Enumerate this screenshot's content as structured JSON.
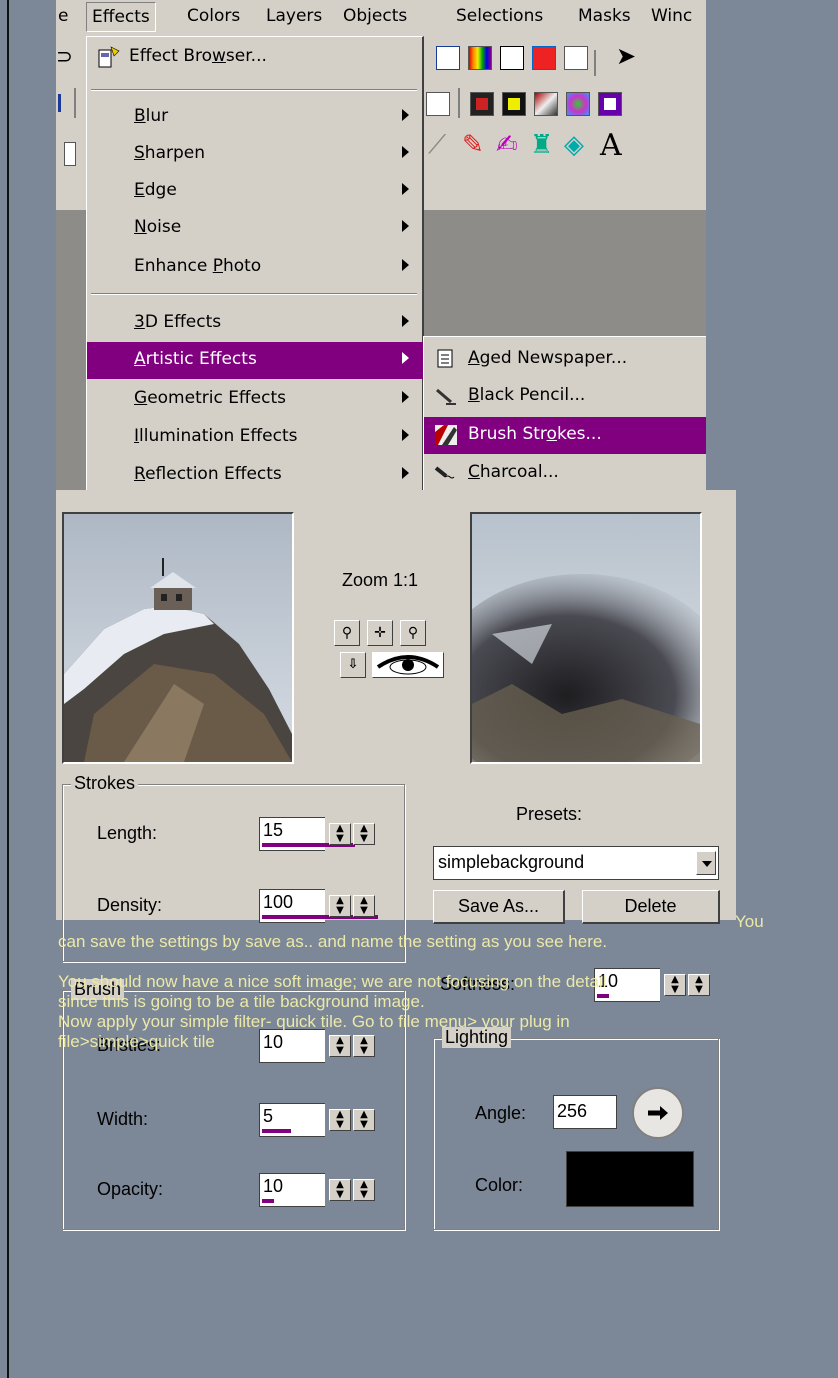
{
  "menubar": {
    "items": [
      {
        "label": "e"
      },
      {
        "label": "Effects"
      },
      {
        "label": "Colors"
      },
      {
        "label": "Layers"
      },
      {
        "label": "Objects"
      },
      {
        "label": "Selections"
      },
      {
        "label": "Masks"
      },
      {
        "label": "Winc"
      }
    ]
  },
  "effects_menu": {
    "browser": {
      "pre": "Effect Bro",
      "u": "w",
      "post": "ser..."
    },
    "group1": [
      {
        "u": "B",
        "rest": "lur"
      },
      {
        "u": "S",
        "rest": "harpen"
      },
      {
        "u": "E",
        "rest": "dge"
      },
      {
        "u": "N",
        "rest": "oise"
      },
      {
        "pre": "Enhance ",
        "u": "P",
        "rest": "hoto"
      }
    ],
    "group2": [
      {
        "u": "3",
        "rest": "D Effects"
      },
      {
        "u": "A",
        "rest": "rtistic Effects"
      },
      {
        "u": "G",
        "rest": "eometric Effects"
      },
      {
        "u": "I",
        "rest": "llumination Effects"
      },
      {
        "u": "R",
        "rest": "eflection Effects"
      }
    ]
  },
  "artistic_submenu": [
    {
      "pre": "",
      "u": "A",
      "rest": "ged Newspaper..."
    },
    {
      "pre": "",
      "u": "B",
      "rest": "lack Pencil..."
    },
    {
      "pre": "Brush Str",
      "u": "o",
      "rest": "kes..."
    },
    {
      "pre": "",
      "u": "C",
      "rest": "harcoal..."
    }
  ],
  "dialog": {
    "zoom_label": "Zoom 1:1",
    "strokes": {
      "title": "Strokes",
      "length": {
        "label": "Length:",
        "value": "15",
        "fill": 0.8
      },
      "density": {
        "label": "Density:",
        "value": "100",
        "fill": 1.0
      }
    },
    "brush": {
      "title": "Brush",
      "bristles": {
        "label": "Bristles:",
        "value": "10",
        "fill": 0.0
      },
      "width": {
        "label": "Width:",
        "value": "5",
        "fill": 0.25
      },
      "opacity": {
        "label": "Opacity:",
        "value": "10",
        "fill": 0.1
      }
    },
    "presets": {
      "label": "Presets:",
      "selected": "simplebackground",
      "save_as": "Save As...",
      "delete": "Delete"
    },
    "softness": {
      "label": "Softness:",
      "value": "10",
      "fill": 0.1
    },
    "lighting": {
      "title": "Lighting",
      "angle_label": "Angle:",
      "angle_value": "256",
      "color_label": "Color:",
      "color_value": "#000000"
    }
  },
  "text": {
    "you": "You",
    "line1": "can save the settings by save as.. and name the setting as you see here.",
    "line2": "You should now have a nice soft image; we are not focusing on the detail",
    "line3": "since this is going to be a tile background image.",
    "line4": "Now apply your simple filter- quick tile.  Go to file menu> your plug in",
    "line5": "file>simple>quick tile"
  }
}
